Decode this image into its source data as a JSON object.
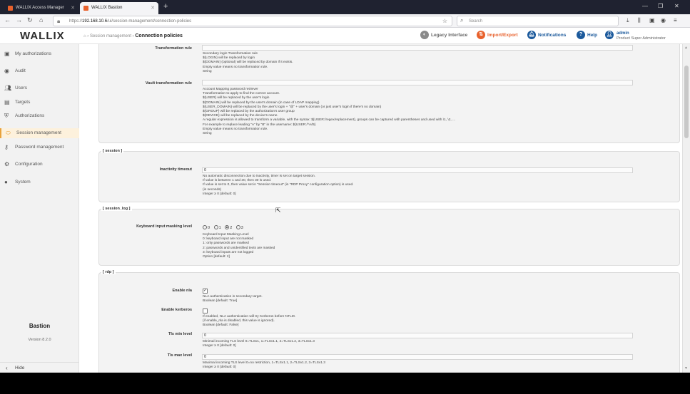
{
  "browser": {
    "tabs": [
      {
        "label": "WALLIX Access Manager"
      },
      {
        "label": "WALLIX Bastion"
      }
    ],
    "url_prefix": "https://",
    "url_host": "192.168.10.6",
    "url_path": "/ui/session-management/connection-policies",
    "search_placeholder": "Search"
  },
  "header": {
    "logo": "WALLIX",
    "breadcrumb_parent": "Session management",
    "breadcrumb_current": "Connection policies",
    "legacy": "Legacy Interface",
    "import_export": "Import/Export",
    "notifications": "Notifications",
    "help": "Help",
    "user_name": "admin",
    "user_role": "Product Super Administrator"
  },
  "sidebar": {
    "items": [
      {
        "label": "My authorizations",
        "icon": "authorizations-icon"
      },
      {
        "label": "Audit",
        "icon": "eye-icon"
      },
      {
        "label": "Users",
        "icon": "users-icon"
      },
      {
        "label": "Targets",
        "icon": "targets-icon"
      },
      {
        "label": "Authorizations",
        "icon": "shield-icon"
      },
      {
        "label": "Session management",
        "icon": "session-icon"
      },
      {
        "label": "Password management",
        "icon": "key-icon"
      },
      {
        "label": "Configuration",
        "icon": "config-icon"
      },
      {
        "label": "System",
        "icon": "system-icon"
      }
    ],
    "product": "Bastion",
    "version": "Version 8.2.0",
    "hide": "Hide"
  },
  "form": {
    "transformation_rule": {
      "label": "Transformation rule",
      "help": [
        "Secondary login Transformation rule",
        "${LOGIN} will be replaced by login",
        "${DOMAIN} (optional) will be replaced by domain if it exists.",
        "Empty value means no transformation rule.",
        "String"
      ]
    },
    "vault_rule": {
      "label": "Vault transformation rule",
      "help": [
        "Account Mapping password retriever",
        "Transformation to apply to find the correct account.",
        "${USER} will be replaced by the user's login",
        "${DOMAIN} will be replaced by the user's domain (in case of LDAP mapping)",
        "${USER_DOMAIN} will be replaced by the user's login + \"@\" + user's domain (or just user's login if there's no domain)",
        "${GROUP} will be replaced by the authorization's user group",
        "${DEVICE} will be replaced by the device's name.",
        "A regular expression is allowed to transform a variable, with the syntax: ${USER:/regex/replacement}, groups can be captured with parentheses and used with \\1, \\2, ...",
        "For example to replace leading \"A\" by \"B\" in the username: ${USER:/^A/B}",
        "Empty value means no transformation rule.",
        "String"
      ]
    },
    "session": {
      "title": "[ session ]",
      "inactivity_label": "Inactivity timeout",
      "inactivity_value": "0",
      "help": [
        "No automatic disconnection due to inactivity, timer is set on target session.",
        "If value is between 1 and 30, then 30 is used.",
        "If value is set to 0, then value set in \"Session timeout\" (in \"RDP Proxy\" configuration option) is used.",
        "(in seconds)",
        "Integer ≥ 0 [default: 0]"
      ]
    },
    "session_log": {
      "title": "[ session_log ]",
      "keyboard_label": "Keyboard input masking level",
      "options": [
        "0",
        "1",
        "2",
        "3"
      ],
      "selected": "2",
      "help": [
        "Keyboard Input Masking Level",
        "0: keyboard input are not masked",
        "1: only passwords are masked",
        "2: passwords and unidentified texts are masked",
        "3: keyboard inputs are not logged",
        "Option [default: 2]"
      ]
    },
    "rdp": {
      "title": "[ rdp ]",
      "nla_label": "Enable nla",
      "nla_checked": true,
      "nla_help": [
        "NLA authentication in secondary target.",
        "Boolean [default: True]"
      ],
      "kerberos_label": "Enable kerberos",
      "kerberos_checked": false,
      "kerberos_help": [
        "If enabled, NLA authentication will try Kerberos before NTLM.",
        "(if enable_nla is disabled, this value is ignored).",
        "Boolean [default: False]"
      ],
      "tls_min_label": "Tls min level",
      "tls_min_value": "0",
      "tls_min_help": [
        "Minimal incoming TLS level 0=TLSv1, 1=TLSv1.1, 2=TLSv1.2, 3=TLSv1.3",
        "Integer ≥ 0 [default: 0]"
      ],
      "tls_max_label": "Tls max level",
      "tls_max_value": "0",
      "tls_max_help": [
        "Maximal incoming TLS level 0=no restriction, 1=TLSv1.1, 2=TLSv1.2, 3=TLSv1.3",
        "Integer ≥ 0 [default: 0]"
      ]
    }
  }
}
